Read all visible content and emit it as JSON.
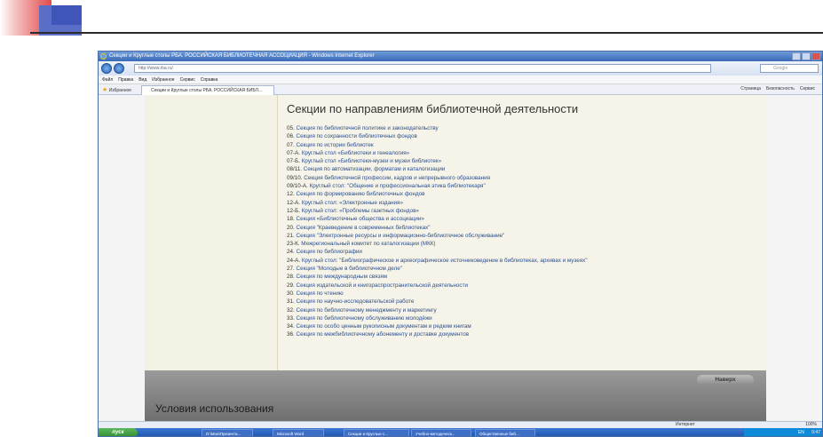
{
  "window": {
    "title": "Секции и Круглые столы РБА. РОССИЙСКАЯ БИБЛИОТЕЧНАЯ АССОЦИАЦИЯ - Windows Internet Explorer",
    "url": "http://www.rba.ru/",
    "search_placeholder": "Google"
  },
  "menu": [
    "Файл",
    "Правка",
    "Вид",
    "Избранное",
    "Сервис",
    "Справка"
  ],
  "favorites_label": "Избранное",
  "tab_label": "Секции и Круглые столы РБА. РОССИЙСКАЯ БИБЛ...",
  "tools": [
    "Страница",
    "Безопасность",
    "Сервис"
  ],
  "page": {
    "heading": "Секции по направлениям библиотечной деятельности",
    "sections": [
      {
        "num": "05.",
        "text": "Секция по библиотечной политике и законодательству"
      },
      {
        "num": "06.",
        "text": "Секция по сохранности библиотечных фондов"
      },
      {
        "num": "07.",
        "text": "Секция по истории библиотек"
      },
      {
        "num": "07-А.",
        "text": "Круглый стол «Библиотеки и генеалогия»"
      },
      {
        "num": "07-Б.",
        "text": "Круглый стол «Библиотеки-музеи и музеи библиотек»"
      },
      {
        "num": "08/11.",
        "text": "Секция по автоматизации, форматам и каталогизации"
      },
      {
        "num": "09/10.",
        "text": "Секция библиотечной профессии, кадров и непрерывного образования"
      },
      {
        "num": "09/10-А.",
        "text": "Круглый стол: \"Общение и профессиональная этика библиотекаря\""
      },
      {
        "num": "12.",
        "text": "Секция по формированию библиотечных фондов"
      },
      {
        "num": "12-А.",
        "text": "Круглый стол: «Электронные издания»"
      },
      {
        "num": "12-Б.",
        "text": "Круглый стол: «Проблемы газетных фондов»"
      },
      {
        "num": "18.",
        "text": "Секция «Библиотечные общества и ассоциации»"
      },
      {
        "num": "20.",
        "text": "Секция \"Краеведение в современных библиотеках\""
      },
      {
        "num": "21.",
        "text": "Секция \"Электронные ресурсы и информационно-библиотечное обслуживание\""
      },
      {
        "num": "23-К.",
        "text": "Межрегиональный комитет по каталогизации (МКК)"
      },
      {
        "num": "24.",
        "text": "Секция по библиографии"
      },
      {
        "num": "24-А.",
        "text": "Круглый стол: \"Библиографическое и археографическое источниковедение в библиотеках, архивах и музеях\""
      },
      {
        "num": "27.",
        "text": "Секция \"Молодые в библиотечном деле\""
      },
      {
        "num": "28.",
        "text": "Секция по международным связям"
      },
      {
        "num": "29.",
        "text": "Секция издательской и книгораспространительской деятельности"
      },
      {
        "num": "30.",
        "text": "Секция по чтению"
      },
      {
        "num": "31.",
        "text": "Секция по научно-исследовательской работе"
      },
      {
        "num": "32.",
        "text": "Секция по библиотечному менеджменту и маркетингу"
      },
      {
        "num": "33.",
        "text": "Секция по библиотечному обслуживанию молодёжи"
      },
      {
        "num": "34.",
        "text": "Секция по особо ценным рукописным документам и редким книгам"
      },
      {
        "num": "36.",
        "text": "Секция по межбиблиотечному абонементу и доставке документов"
      }
    ],
    "top_button": "Наверх",
    "terms_heading": "Условия использования"
  },
  "status": {
    "zone": "Интернет",
    "zoom": "100%"
  },
  "taskbar": {
    "start": "пуск",
    "items": [
      "D:\\Мои\\Презента...",
      "Microsoft Word",
      "Секции и Круглые с...",
      "Учебно-методическ...",
      "Общественные биб..."
    ],
    "lang": "EN",
    "time": "0:47"
  }
}
